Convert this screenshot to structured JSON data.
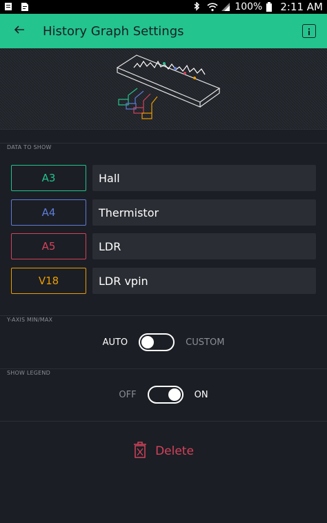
{
  "status_bar": {
    "battery": "100%",
    "time": "2:11 AM"
  },
  "app_bar": {
    "title": "History Graph Settings",
    "back_icon": "arrow-left-icon",
    "info_icon": "info-icon"
  },
  "data_section": {
    "label": "DATA TO SHOW",
    "items": [
      {
        "pin": "A3",
        "name": "Hall",
        "color": "#23c48e"
      },
      {
        "pin": "A4",
        "name": "Thermistor",
        "color": "#5f7cd8"
      },
      {
        "pin": "A5",
        "name": "LDR",
        "color": "#d3435c"
      },
      {
        "pin": "V18",
        "name": "LDR vpin",
        "color": "#ed9d00"
      }
    ]
  },
  "y_axis": {
    "label": "Y-AXIS MIN/MAX",
    "left_option": "AUTO",
    "right_option": "CUSTOM",
    "state": "AUTO"
  },
  "legend": {
    "label": "SHOW LEGEND",
    "left_option": "OFF",
    "right_option": "ON",
    "state": "ON"
  },
  "delete": {
    "label": "Delete",
    "icon": "trash-icon",
    "color": "#d3435c"
  },
  "colors": {
    "accent": "#23c48e",
    "background": "#1b1e24"
  }
}
